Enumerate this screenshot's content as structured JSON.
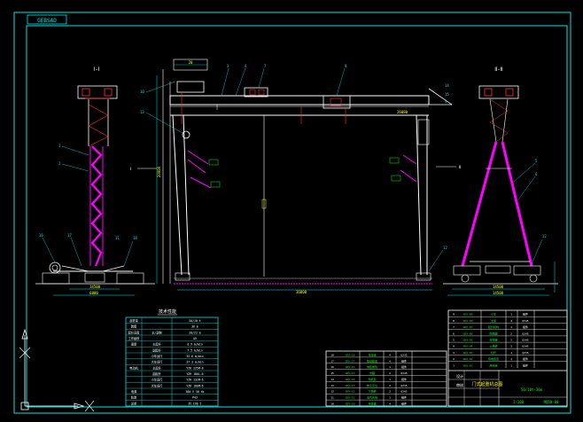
{
  "drawing": {
    "title_tab": "GEBSAD",
    "side_view_label_left": "Ⅰ-Ⅰ",
    "side_view_label_right": "Ⅱ-Ⅱ",
    "section_mark_left": "Ⅰ",
    "section_mark_right": "Ⅱ",
    "dims": {
      "span": "36000",
      "leg_base_left_1": "14500",
      "leg_base_left_2": "6000",
      "leg_base_right_1": "14500",
      "leg_base_right_2": "14500",
      "beam_top": "26080",
      "height": "20000",
      "rail": "20"
    },
    "balloons": [
      "1",
      "2",
      "3",
      "4",
      "5",
      "6",
      "7",
      "8",
      "9",
      "10",
      "11",
      "12",
      "13",
      "14",
      "15",
      "16",
      "17",
      "18"
    ],
    "spec_table_title": "技术性能",
    "spec_rows": [
      [
        "起重量",
        "",
        "50/10 t"
      ],
      [
        "跨度",
        "",
        "36 m"
      ],
      [
        "起升高度",
        "主/副钩",
        "20/22 m"
      ],
      [
        "工作级别",
        "",
        "A5"
      ],
      [
        "速度",
        "主起升",
        "0.9 m/min"
      ],
      [
        "",
        "副起升",
        "7.5 m/min"
      ],
      [
        "",
        "小车运行",
        "35.6 m/min"
      ],
      [
        "",
        "大车运行",
        "37.3 m/min"
      ],
      [
        "电动机",
        "主起升",
        "YZR 225M-8"
      ],
      [
        "",
        "副起升",
        "YZR 180L-6"
      ],
      [
        "",
        "小车运行",
        "YZR 132M-6"
      ],
      [
        "",
        "大车运行",
        "YZR 160M-6"
      ],
      [
        "电源",
        "",
        "380 V 50 Hz"
      ],
      [
        "轨道",
        "",
        "P43"
      ],
      [
        "总重",
        "",
        "约 190 t"
      ]
    ],
    "parts_list_rows": [
      [
        "18",
        "GDX-18",
        "车轮组",
        "4",
        "Q235",
        ""
      ],
      [
        "17",
        "GDX-17",
        "驱动装置",
        "4",
        "组件",
        ""
      ],
      [
        "16",
        "GDX-16",
        "电缆卷筒",
        "1",
        "组件",
        ""
      ],
      [
        "15",
        "GDX-15",
        "支腿",
        "2",
        "Q345",
        ""
      ],
      [
        "14",
        "GDX-14",
        "司机室",
        "1",
        "组件",
        ""
      ],
      [
        "13",
        "GDX-13",
        "梯子平台",
        "2",
        "Q235",
        ""
      ],
      [
        "12",
        "GDX-12",
        "下横梁",
        "2",
        "Q345",
        ""
      ],
      [
        "11",
        "GDX-11",
        "电气系统",
        "1",
        "组件",
        ""
      ],
      [
        "10",
        "GDX-10",
        "夹轨器",
        "4",
        "组件",
        ""
      ]
    ],
    "parts_list_rows_right": [
      [
        "9",
        "GDX-09",
        "小车",
        "1",
        "组件",
        ""
      ],
      [
        "8",
        "GDX-08",
        "主梁",
        "2",
        "Q345",
        ""
      ],
      [
        "7",
        "GDX-07",
        "起升机构",
        "1",
        "组件",
        ""
      ],
      [
        "6",
        "GDX-06",
        "刚性腿",
        "2",
        "Q345",
        ""
      ],
      [
        "5",
        "GDX-05",
        "挠性腿",
        "2",
        "Q345",
        ""
      ],
      [
        "4",
        "GDX-04",
        "上横梁",
        "2",
        "Q345",
        ""
      ],
      [
        "3",
        "GDX-03",
        "栏杆",
        "1",
        "Q235",
        ""
      ],
      [
        "2",
        "GDX-02",
        "导电装置",
        "1",
        "组件",
        ""
      ],
      [
        "1",
        "GDX-01",
        "吊钩组",
        "1",
        "组件",
        ""
      ]
    ],
    "title_block": {
      "name": "门式起重机总图",
      "model": "50/10t-36m",
      "drawing_no": "MQ50-00",
      "scale": "1:100",
      "label_design": "设计",
      "label_check": "审核"
    },
    "colors": {
      "frame": "#00e5e5",
      "lines": "#ffffff",
      "accent": "#ff00ff",
      "red": "#ff3030",
      "green": "#00ff00",
      "yellow": "#ffff00"
    }
  }
}
